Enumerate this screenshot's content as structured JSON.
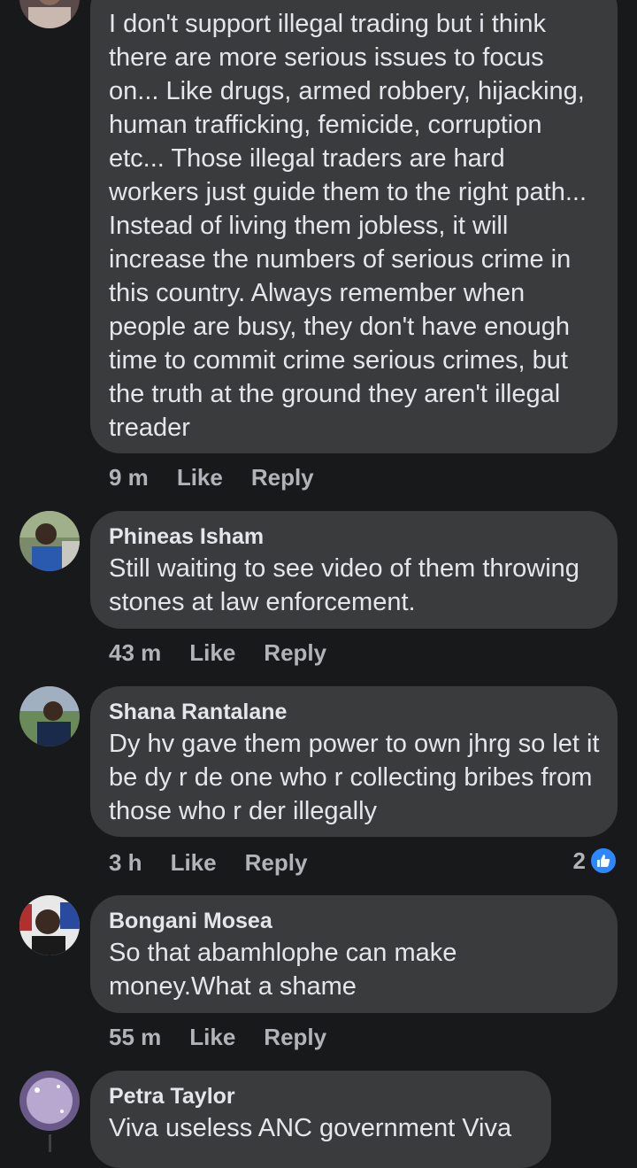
{
  "comments": [
    {
      "author": "",
      "text": "I don't support illegal trading but i think there are more serious issues to focus on... Like drugs, armed robbery, hijacking, human trafficking, femicide, corruption etc... Those illegal traders are hard workers just guide them to the right path... Instead of living them jobless, it will increase the numbers of serious crime in this country. Always remember when people are busy, they don't have enough time to commit crime serious crimes, but the truth at the ground they aren't illegal treader",
      "time": "9 m",
      "like_label": "Like",
      "reply_label": "Reply"
    },
    {
      "author": "Phineas Isham",
      "text": "Still waiting to see video of them throwing stones at law enforcement.",
      "time": "43 m",
      "like_label": "Like",
      "reply_label": "Reply"
    },
    {
      "author": "Shana Rantalane",
      "text": "Dy hv gave them power to own jhrg so let it be dy r de one who r collecting bribes from those who r der illegally",
      "time": "3 h",
      "like_label": "Like",
      "reply_label": "Reply",
      "reaction_count": "2",
      "reaction_icon": "thumbs-up-icon"
    },
    {
      "author": "Bongani Mosea",
      "text": "So that abamhlophe can make money.What a shame",
      "time": "55 m",
      "like_label": "Like",
      "reply_label": "Reply"
    },
    {
      "author": "Petra Taylor",
      "text": "Viva useless ANC government Viva"
    }
  ],
  "colors": {
    "background": "#18191a",
    "bubble": "#3a3b3c",
    "text": "#e4e6eb",
    "meta": "#b0b3b8",
    "reaction": "#2d88ff"
  }
}
